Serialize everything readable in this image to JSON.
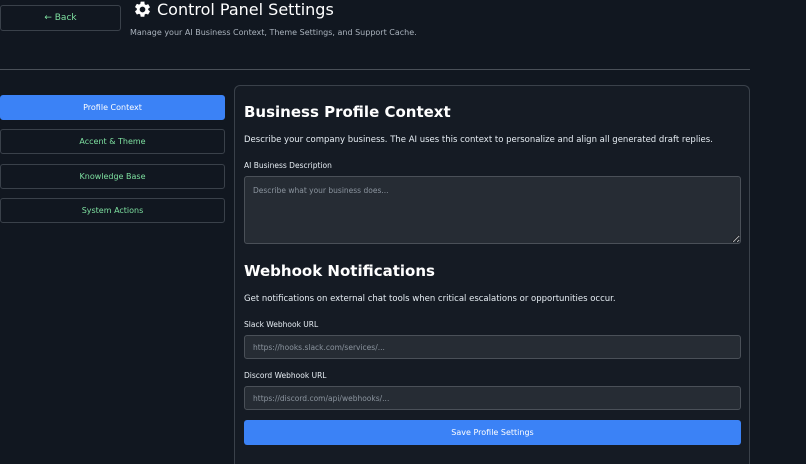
{
  "header": {
    "back_label": "← Back",
    "title": "Control Panel Settings",
    "subtitle": "Manage your AI Business Context, Theme Settings, and Support Cache.",
    "title_icon": "gear-icon"
  },
  "sidebar": {
    "items": [
      {
        "label": "Profile Context",
        "active": true
      },
      {
        "label": "Accent & Theme",
        "active": false
      },
      {
        "label": "Knowledge Base",
        "active": false
      },
      {
        "label": "System Actions",
        "active": false
      }
    ]
  },
  "main": {
    "business": {
      "title": "Business Profile Context",
      "description": "Describe your company business. The AI uses this context to personalize and align all generated draft replies.",
      "field_label": "AI Business Description",
      "field_value": "",
      "field_placeholder": "Describe what your business does..."
    },
    "webhooks": {
      "title": "Webhook Notifications",
      "description": "Get notifications on external chat tools when critical escalations or opportunities occur.",
      "slack_label": "Slack Webhook URL",
      "slack_value": "",
      "slack_placeholder": "https://hooks.slack.com/services/...",
      "discord_label": "Discord Webhook URL",
      "discord_value": "",
      "discord_placeholder": "https://discord.com/api/webhooks/..."
    },
    "save_label": "Save Profile Settings"
  },
  "colors": {
    "background": "#111720",
    "accent": "#3b82f6",
    "nav_text": "#7ee0a0"
  }
}
